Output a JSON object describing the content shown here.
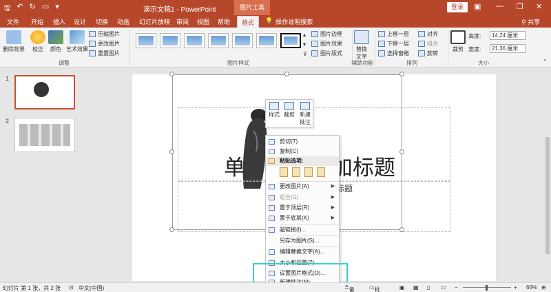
{
  "titlebar": {
    "doc_title": "演示文稿1 - PowerPoint",
    "context_tools": "图片工具",
    "login": "登录",
    "minimize": "—",
    "restore": "❐",
    "close": "✕"
  },
  "tabs": [
    "文件",
    "开始",
    "插入",
    "设计",
    "切换",
    "动画",
    "幻灯片放映",
    "审阅",
    "视图",
    "帮助",
    "格式"
  ],
  "tellme": "操作说明搜索",
  "share": "共享",
  "ribbon": {
    "adjust": {
      "remove_bg": "删除背景",
      "correct": "校正",
      "color": "颜色",
      "effects": "艺术效果",
      "compress": "压缩图片",
      "change": "更改图片",
      "reset": "重置图片",
      "group_label": "调整"
    },
    "styles": {
      "border": "图片边框",
      "effects": "图片效果",
      "layout": "图片版式",
      "group_label": "图片样式"
    },
    "accessibility": {
      "alt_text": "替换文字",
      "group_label": "辅助功能"
    },
    "arrange": {
      "forward": "上移一层",
      "backward": "下移一层",
      "pane": "选择窗格",
      "align": "对齐",
      "group": "组合",
      "rotate": "旋转",
      "group_label": "排列"
    },
    "size": {
      "crop": "裁剪",
      "height_label": "高度:",
      "height_value": "14.24 厘米",
      "width_label": "宽度:",
      "width_value": "21.36 厘米",
      "group_label": "大小"
    }
  },
  "thumbnails": [
    {
      "number": "1"
    },
    {
      "number": "2"
    }
  ],
  "slide": {
    "title_left": "单",
    "title_right": "添加标题",
    "subtitle": "副标题"
  },
  "minitoolbar": {
    "style": "样式",
    "crop": "裁剪",
    "new_comment": "新建批注"
  },
  "context_menu": {
    "cut": "剪切(T)",
    "copy": "复制(C)",
    "paste_options": "粘贴选项:",
    "change_picture": "更改图片(A)",
    "group": "组合(G)",
    "bring_front": "置于顶层(R)",
    "send_back": "置于底层(K)",
    "link": "超链接(I)...",
    "save_as": "另存为图片(S)...",
    "alt_text": "编辑替换文字(A)...",
    "size_position": "大小和位置(Z)...",
    "format_picture": "设置图片格式(O)...",
    "new_comment": "新建批注(M)"
  },
  "statusbar": {
    "slide_info": "幻灯片 第 1 张，共 2 张",
    "language": "中文(中国)",
    "notes": "备注",
    "comments": "批注",
    "zoom": "66%"
  }
}
